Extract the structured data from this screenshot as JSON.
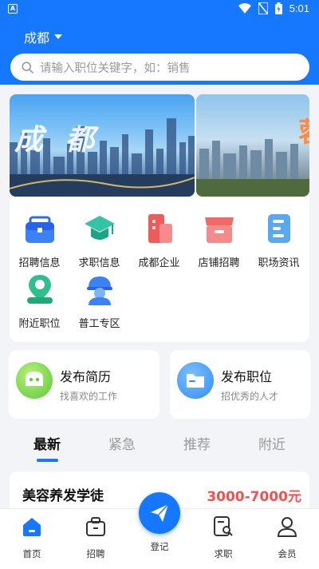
{
  "status_bar": {
    "time": "5:01",
    "notification_icon": "A"
  },
  "header": {
    "city": "成都",
    "search_placeholder": "请输入职位关键字，如：销售",
    "accent_color": "#1677ff"
  },
  "banner": {
    "main_text": "成都",
    "side_text": "蓉"
  },
  "menu": [
    {
      "label": "招聘信息",
      "icon": "briefcase-icon"
    },
    {
      "label": "求职信息",
      "icon": "graduation-cap-icon"
    },
    {
      "label": "成都企业",
      "icon": "building-icon"
    },
    {
      "label": "店铺招聘",
      "icon": "shop-icon"
    },
    {
      "label": "职场资讯",
      "icon": "news-icon"
    },
    {
      "label": "附近职位",
      "icon": "location-person-icon"
    },
    {
      "label": "普工专区",
      "icon": "worker-helmet-icon"
    }
  ],
  "publish": [
    {
      "title": "发布简历",
      "subtitle": "找喜欢的工作",
      "icon": "resume-icon"
    },
    {
      "title": "发布职位",
      "subtitle": "招优秀的人才",
      "icon": "folder-icon"
    }
  ],
  "tabs": [
    {
      "label": "最新",
      "active": true
    },
    {
      "label": "紧急",
      "active": false
    },
    {
      "label": "推荐",
      "active": false
    },
    {
      "label": "附近",
      "active": false
    }
  ],
  "jobs": [
    {
      "title": "美容养发学徒",
      "salary": "3000-7000元"
    }
  ],
  "bottom_nav": {
    "items": [
      {
        "label": "首页",
        "icon": "home-icon",
        "active": true
      },
      {
        "label": "招聘",
        "icon": "briefcase-icon"
      },
      {
        "label": "求职",
        "icon": "search-document-icon"
      },
      {
        "label": "会员",
        "icon": "user-icon"
      }
    ],
    "center": {
      "label": "登记",
      "icon": "paper-plane-icon"
    }
  }
}
